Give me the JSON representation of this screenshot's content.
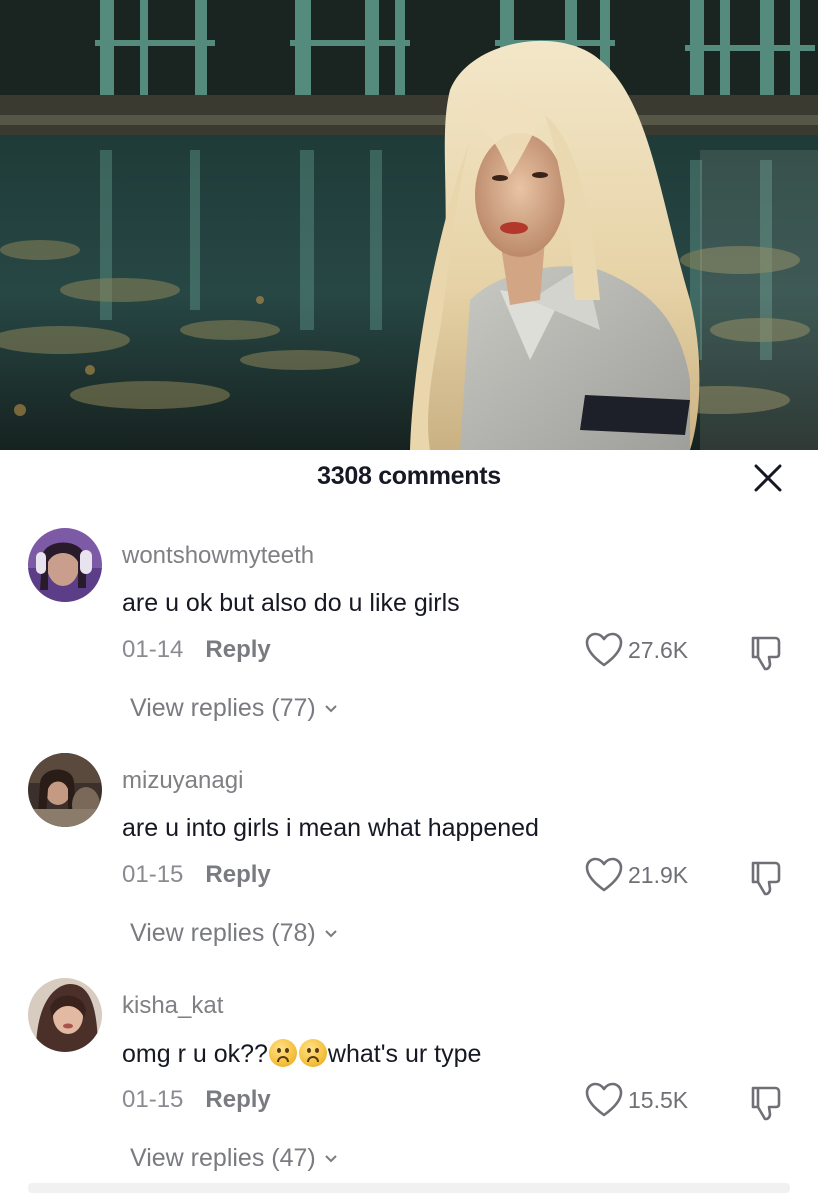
{
  "video": {
    "description_icon": "video-still"
  },
  "header": {
    "comment_count": "3308 comments",
    "close_icon": "close-icon"
  },
  "comments": [
    {
      "username": "wontshowmyteeth",
      "text": "are u ok but also do u like girls",
      "date": "01-14",
      "reply_label": "Reply",
      "likes": "27.6K",
      "view_replies": "View replies (77)"
    },
    {
      "username": "mizuyanagi",
      "text": "are u into girls i mean what happened",
      "date": "01-15",
      "reply_label": "Reply",
      "likes": "21.9K",
      "view_replies": "View replies (78)"
    },
    {
      "username": "kisha_kat",
      "text_before": "omg r u ok??",
      "text_after": "what's ur type",
      "date": "01-15",
      "reply_label": "Reply",
      "likes": "15.5K",
      "view_replies": "View replies (47)"
    }
  ],
  "colors": {
    "text_primary": "#161823",
    "text_secondary": "#8a8b91",
    "background": "#ffffff"
  }
}
